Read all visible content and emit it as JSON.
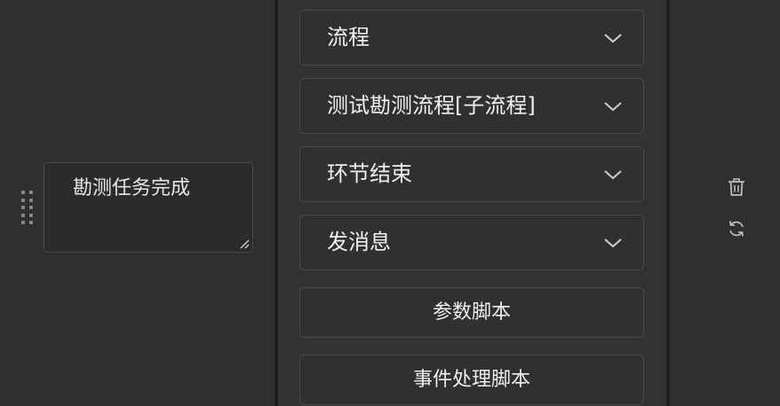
{
  "editor": {
    "text_value": "勘测任务完成"
  },
  "selects": [
    {
      "value": "流程"
    },
    {
      "value": "测试勘测流程[子流程]"
    },
    {
      "value": "环节结束"
    },
    {
      "value": "发消息"
    }
  ],
  "buttons": {
    "param_script": "参数脚本",
    "event_script": "事件处理脚本"
  },
  "icons": {
    "drag": "drag-handle-icon",
    "chevron": "chevron-down-icon",
    "delete": "trash-icon",
    "refresh": "refresh-icon"
  }
}
